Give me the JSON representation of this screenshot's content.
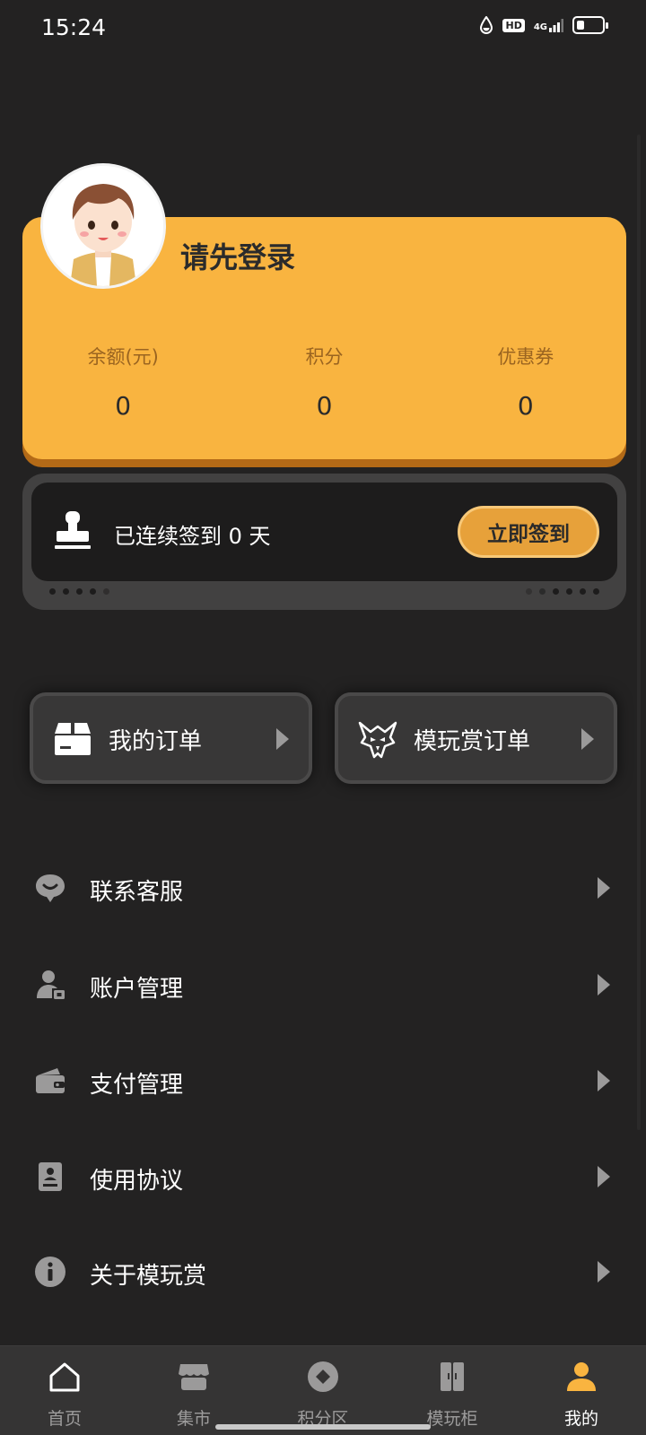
{
  "status_bar": {
    "time": "15:24",
    "hd_label": "HD",
    "network_label": "4G",
    "battery_level": 0.3
  },
  "profile": {
    "login_prompt": "请先登录",
    "stats": [
      {
        "label": "余额(元)",
        "value": "0"
      },
      {
        "label": "积分",
        "value": "0"
      },
      {
        "label": "优惠券",
        "value": "0"
      }
    ]
  },
  "checkin": {
    "status_text": "已连续签到 0 天",
    "button_label": "立即签到"
  },
  "orders": {
    "my_orders_label": "我的订单",
    "mowanshang_orders_label": "模玩赏订单"
  },
  "menu": {
    "items": [
      {
        "label": "联系客服",
        "icon": "chat-bubble-icon"
      },
      {
        "label": "账户管理",
        "icon": "user-lock-icon"
      },
      {
        "label": "支付管理",
        "icon": "wallet-icon"
      },
      {
        "label": "使用协议",
        "icon": "document-icon"
      },
      {
        "label": "关于模玩赏",
        "icon": "info-icon"
      }
    ]
  },
  "bottom_nav": {
    "items": [
      {
        "label": "首页",
        "icon": "home-icon"
      },
      {
        "label": "集市",
        "icon": "store-icon"
      },
      {
        "label": "积分区",
        "icon": "points-icon"
      },
      {
        "label": "模玩柜",
        "icon": "cabinet-icon"
      },
      {
        "label": "我的",
        "icon": "profile-icon"
      }
    ],
    "active": "我的"
  },
  "colors": {
    "background": "#232222",
    "accent": "#f9b440",
    "button": "#e7a13a",
    "card": "#383737"
  }
}
